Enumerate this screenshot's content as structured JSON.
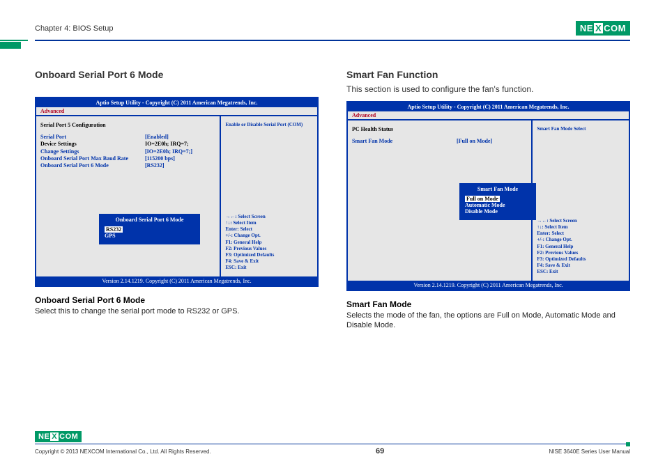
{
  "header": {
    "chapter": "Chapter 4: BIOS Setup",
    "logo_text": "NEXCOM"
  },
  "left": {
    "title": "Onboard Serial Port 6 Mode",
    "bios_title": "Aptio Setup Utility - Copyright (C) 2011 American Megatrends, Inc.",
    "tab": "Advanced",
    "group": "Serial Port 5 Configuration",
    "rows": [
      {
        "label": "Serial Port",
        "value": "[Enabled]",
        "lcls": "blue",
        "vcls": "blue"
      },
      {
        "label": "Device Settings",
        "value": "IO=2E0h; IRQ=7;",
        "lcls": "black",
        "vcls": "black"
      },
      {
        "label": "",
        "value": ""
      },
      {
        "label": "Change Settings",
        "value": "[IO=2E0h; IRQ=7;]",
        "lcls": "blue",
        "vcls": "blue"
      },
      {
        "label": "Onboard Serial Port Max Baud Rate",
        "value": "[115200 bps]",
        "lcls": "blue",
        "vcls": "blue"
      },
      {
        "label": "Onboard Serial Port 6 Mode",
        "value": "[RS232]",
        "lcls": "blue",
        "vcls": "blue"
      }
    ],
    "popup": {
      "title": "Onboard Serial Port 6 Mode",
      "sel": "RS232",
      "opt": "GPS"
    },
    "right_top": "Enable or Disable Serial Port (COM)",
    "help": [
      "→←: Select Screen",
      "↑↓: Select Item",
      "Enter: Select",
      "+/-: Change Opt.",
      "F1: General Help",
      "F2: Previous Values",
      "F3: Optimized Defaults",
      "F4: Save & Exit",
      "ESC: Exit"
    ],
    "version": "Version 2.14.1219. Copyright (C) 2011 American Megatrends, Inc.",
    "sub_head": "Onboard Serial Port 6 Mode",
    "sub_desc": "Select this to change the serial port mode to RS232 or GPS."
  },
  "right": {
    "title": "Smart Fan Function",
    "desc": "This section is used to configure the fan's function.",
    "bios_title": "Aptio Setup Utility - Copyright (C) 2011 American Megatrends, Inc.",
    "tab": "Advanced",
    "group": "PC Health Status",
    "rows": [
      {
        "label": "Smart Fan Mode",
        "value": "[Full on Mode]",
        "lcls": "blue",
        "vcls": "blue"
      }
    ],
    "popup": {
      "title": "Smart Fan Mode",
      "sel": "Full on Mode",
      "opt1": "Automatic Mode",
      "opt2": "Disable Mode"
    },
    "right_top": "Smart Fan Mode Select",
    "help": [
      "→←: Select Screen",
      "↑↓: Select Item",
      "Enter: Select",
      "+/-: Change Opt.",
      "F1: General Help",
      "F2: Previous Values",
      "F3: Optimized Defaults",
      "F4: Save & Exit",
      "ESC: Exit"
    ],
    "version": "Version 2.14.1219. Copyright (C) 2011 American Megatrends, Inc.",
    "sub_head": "Smart Fan Mode",
    "sub_desc": "Selects the mode of the fan, the options are Full on Mode, Automatic Mode and Disable Mode."
  },
  "footer": {
    "copyright": "Copyright © 2013 NEXCOM International Co., Ltd. All Rights Reserved.",
    "page": "69",
    "manual": "NISE 3640E Series User Manual"
  }
}
